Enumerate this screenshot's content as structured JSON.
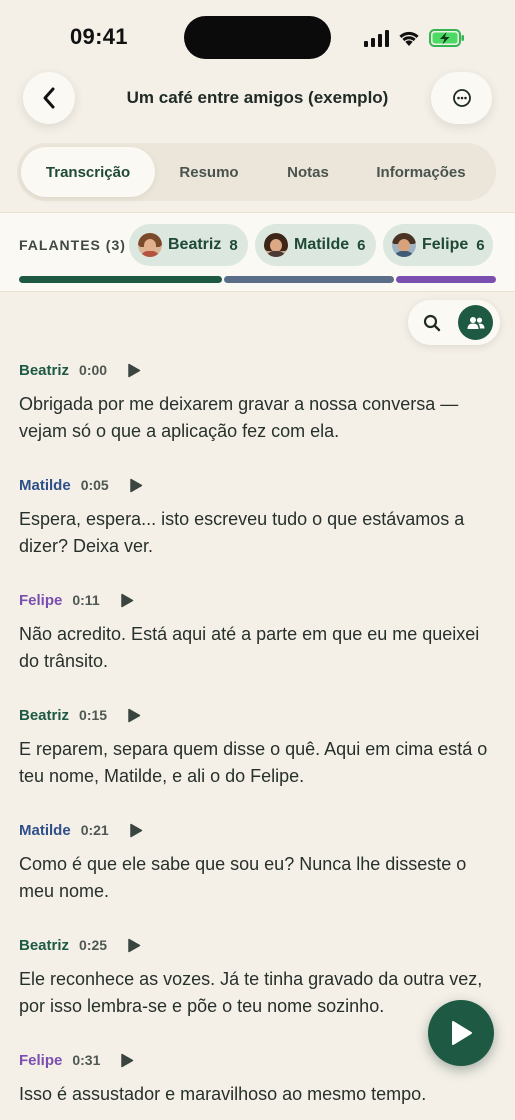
{
  "status_bar": {
    "time": "09:41"
  },
  "header": {
    "title": "Um café entre amigos (exemplo)"
  },
  "tabs": [
    {
      "label": "Transcrição",
      "active": true
    },
    {
      "label": "Resumo",
      "active": false
    },
    {
      "label": "Notas",
      "active": false
    },
    {
      "label": "Informações",
      "active": false
    }
  ],
  "speakers": {
    "label": "FALANTES (3)",
    "list": [
      {
        "name": "Beatriz",
        "count": "8",
        "color": "#1e5a43"
      },
      {
        "name": "Matilde",
        "count": "6",
        "color": "#5a6e8a"
      },
      {
        "name": "Felipe",
        "count": "6",
        "color": "#7a4fb0"
      }
    ],
    "share_segments": [
      {
        "speaker": "Beatriz",
        "fraction": 0.43
      },
      {
        "speaker": "Matilde",
        "fraction": 0.36
      },
      {
        "speaker": "Felipe",
        "fraction": 0.21
      }
    ]
  },
  "colors": {
    "beatriz": "#1e5a43",
    "matilde": "#2f4f8a",
    "felipe": "#7a4fb0",
    "accent": "#1e5a43",
    "background": "#f4f0e8"
  },
  "transcript": [
    {
      "speaker": "Beatriz",
      "time": "0:00",
      "text": "Obrigada por me deixarem gravar a nossa conversa — vejam só o que a aplicação fez com ela."
    },
    {
      "speaker": "Matilde",
      "time": "0:05",
      "text": "Espera, espera... isto escreveu tudo o que estávamos a dizer? Deixa ver."
    },
    {
      "speaker": "Felipe",
      "time": "0:11",
      "text": "Não acredito. Está aqui até a parte em que eu me queixei do trânsito."
    },
    {
      "speaker": "Beatriz",
      "time": "0:15",
      "text": "E reparem, separa quem disse o quê. Aqui em cima está o teu nome, Matilde, e ali o do Felipe."
    },
    {
      "speaker": "Matilde",
      "time": "0:21",
      "text": "Como é que ele sabe que sou eu? Nunca lhe disseste o meu nome."
    },
    {
      "speaker": "Beatriz",
      "time": "0:25",
      "text": "Ele reconhece as vozes. Já te tinha gravado da outra vez, por isso lembra-se e põe o teu nome sozinho."
    },
    {
      "speaker": "Felipe",
      "time": "0:31",
      "text": "Isso é assustador e maravilhoso ao mesmo tempo."
    }
  ],
  "icons": {
    "back": "chevron-left-icon",
    "more": "more-horizontal-icon",
    "search": "search-icon",
    "speakers_filter": "people-icon",
    "play": "play-icon"
  }
}
